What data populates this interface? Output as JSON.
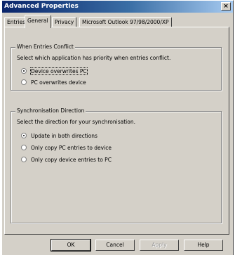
{
  "window": {
    "title": "Advanced Properties",
    "close_glyph": "×"
  },
  "tabs": [
    {
      "label": "Entries"
    },
    {
      "label": "General"
    },
    {
      "label": "Privacy"
    },
    {
      "label": "Microsoft Outlook 97/98/2000/XP"
    }
  ],
  "active_tab": "General",
  "conflict_group": {
    "title": "When Entries Conflict",
    "description": "Select which application has priority when entries conflict.",
    "options": [
      {
        "label": "Device overwrites PC",
        "selected": true
      },
      {
        "label": "PC overwrites device",
        "selected": false
      }
    ]
  },
  "sync_group": {
    "title": "Synchronisation Direction",
    "description": "Select the direction for your synchronisation.",
    "options": [
      {
        "label": "Update in both directions",
        "selected": true
      },
      {
        "label": "Only copy PC entries to device",
        "selected": false
      },
      {
        "label": "Only copy device entries to PC",
        "selected": false
      }
    ]
  },
  "buttons": {
    "ok": "OK",
    "cancel": "Cancel",
    "apply": "Apply",
    "help": "Help"
  },
  "colors": {
    "title_start": "#0a246a",
    "title_end": "#a6caf0",
    "face": "#d4d0c8"
  }
}
